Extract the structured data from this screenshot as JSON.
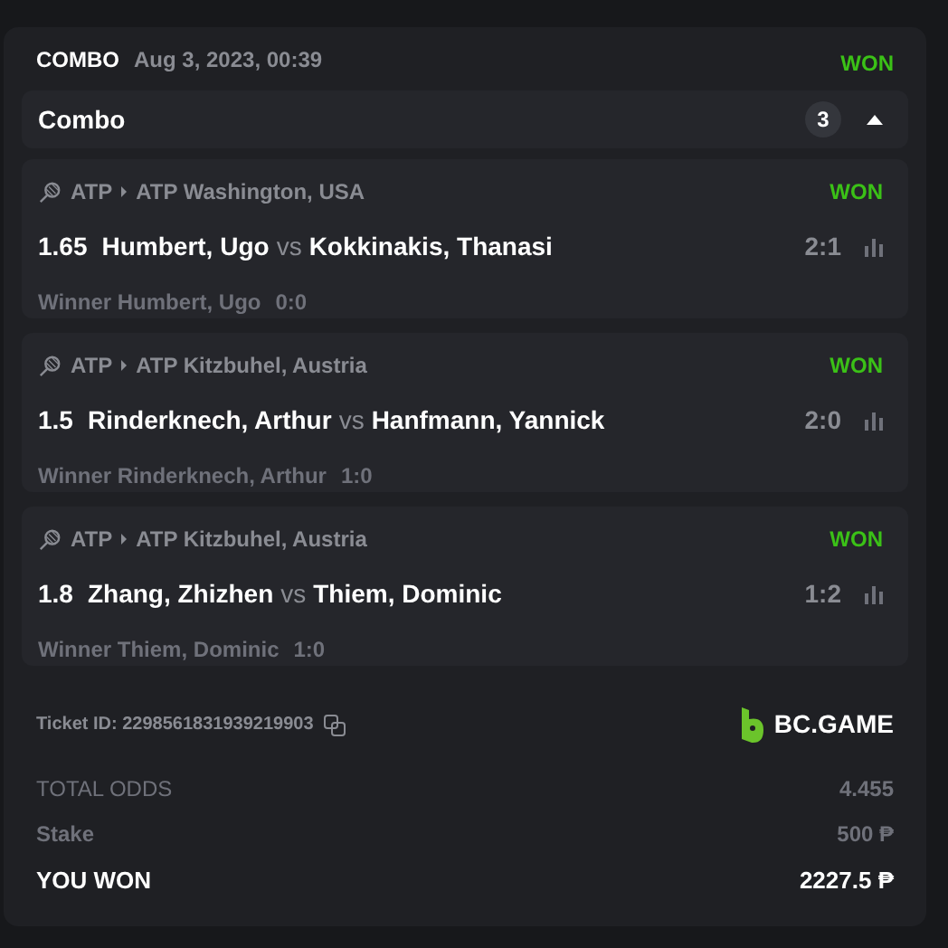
{
  "header": {
    "type": "COMBO",
    "date": "Aug 3, 2023, 00:39",
    "status": "WON",
    "won": true
  },
  "combo": {
    "title": "Combo",
    "count": "3",
    "expanded": true
  },
  "selections": [
    {
      "sport": "ATP",
      "league": "ATP Washington, USA",
      "status": "WON",
      "won": true,
      "odds": "1.65",
      "home": "Humbert, Ugo",
      "vs": "vs",
      "away": "Kokkinakis, Thanasi",
      "score": "2:1",
      "market": "Winner Humbert, Ugo",
      "market_score": "0:0"
    },
    {
      "sport": "ATP",
      "league": "ATP Kitzbuhel, Austria",
      "status": "WON",
      "won": true,
      "odds": "1.5",
      "home": "Rinderknech, Arthur",
      "vs": "vs",
      "away": "Hanfmann, Yannick",
      "score": "2:0",
      "market": "Winner Rinderknech, Arthur",
      "market_score": "1:0"
    },
    {
      "sport": "ATP",
      "league": "ATP Kitzbuhel, Austria",
      "status": "WON",
      "won": true,
      "odds": "1.8",
      "home": "Zhang, Zhizhen",
      "vs": "vs",
      "away": "Thiem, Dominic",
      "score": "1:2",
      "market": "Winner Thiem, Dominic",
      "market_score": "1:0"
    }
  ],
  "ticket": {
    "label": "Ticket ID: 2298561831939219903",
    "brand": "BC.GAME"
  },
  "totals": [
    {
      "kind": "plain",
      "label": "TOTAL ODDS",
      "value": "4.455"
    },
    {
      "kind": "plain",
      "label": "Stake",
      "value": "500 ₱"
    },
    {
      "kind": "highlight",
      "label": "YOU WON",
      "value": "2227.5 ₱"
    }
  ]
}
